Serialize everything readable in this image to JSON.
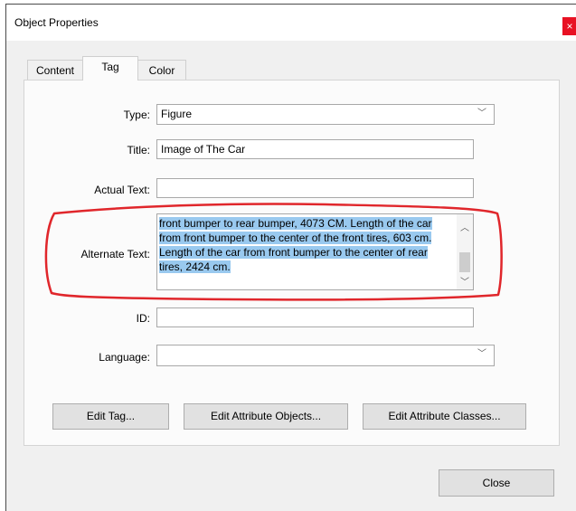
{
  "window": {
    "title": "Object Properties",
    "close_glyph": "×"
  },
  "tabs": [
    {
      "label": "Content"
    },
    {
      "label": "Tag"
    },
    {
      "label": "Color"
    }
  ],
  "form": {
    "type_label": "Type:",
    "type_value": "Figure",
    "title_label": "Title:",
    "title_value": "Image of The Car",
    "actual_text_label": "Actual Text:",
    "actual_text_value": "",
    "alternate_text_label": "Alternate Text:",
    "alternate_text_value": "front bumper to rear bumper, 4073 CM. Length of the car from front bumper to the center of the front tires, 603 cm. Length of the car from front bumper to the center of rear tires, 2424 cm.",
    "id_label": "ID:",
    "id_value": "",
    "language_label": "Language:",
    "language_value": ""
  },
  "buttons": {
    "edit_tag": "Edit Tag...",
    "edit_attribute_objects": "Edit Attribute Objects...",
    "edit_attribute_classes": "Edit Attribute Classes...",
    "close": "Close"
  },
  "icons": {
    "dropdown": "chevron-down-icon",
    "scroll_up": "arrow-up-icon",
    "scroll_down": "arrow-down-icon"
  },
  "colors": {
    "selection": "#99c9ef",
    "annotation": "#e0262b",
    "close_button": "#e81123"
  }
}
